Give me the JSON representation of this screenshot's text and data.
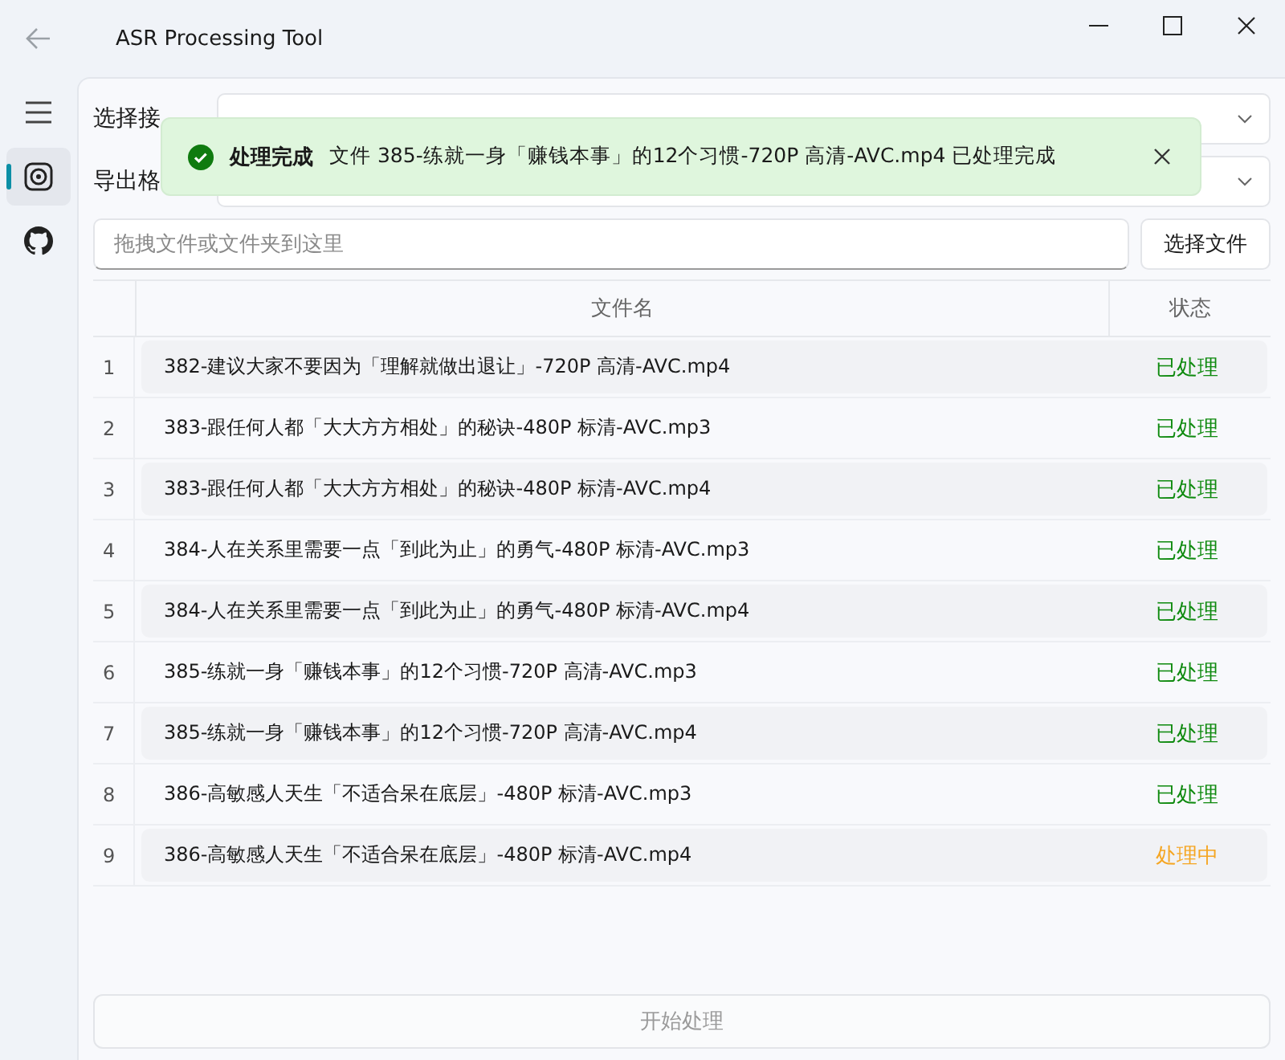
{
  "window": {
    "title": "ASR Processing Tool"
  },
  "sidebar": {
    "items": [
      {
        "kind": "menu",
        "selected": false
      },
      {
        "kind": "disc",
        "selected": true
      },
      {
        "kind": "github",
        "selected": false
      }
    ]
  },
  "form": {
    "interface_label": "选择接",
    "format_label": "导出格",
    "drop_placeholder": "拖拽文件或文件夹到这里",
    "choose_button": "选择文件"
  },
  "toast": {
    "title": "处理完成",
    "message": "文件 385-练就一身「赚钱本事」的12个习惯-720P 高清-AVC.mp4 已处理完成"
  },
  "table": {
    "columns": [
      "文件名",
      "状态"
    ],
    "rows": [
      {
        "index": "1",
        "name": "382-建议大家不要因为「理解就做出退让」-720P 高清-AVC.mp4",
        "status": "已处理",
        "kind": "done"
      },
      {
        "index": "2",
        "name": "383-跟任何人都「大大方方相处」的秘诀-480P 标清-AVC.mp3",
        "status": "已处理",
        "kind": "done"
      },
      {
        "index": "3",
        "name": "383-跟任何人都「大大方方相处」的秘诀-480P 标清-AVC.mp4",
        "status": "已处理",
        "kind": "done"
      },
      {
        "index": "4",
        "name": "384-人在关系里需要一点「到此为止」的勇气-480P 标清-AVC.mp3",
        "status": "已处理",
        "kind": "done"
      },
      {
        "index": "5",
        "name": "384-人在关系里需要一点「到此为止」的勇气-480P 标清-AVC.mp4",
        "status": "已处理",
        "kind": "done"
      },
      {
        "index": "6",
        "name": "385-练就一身「赚钱本事」的12个习惯-720P 高清-AVC.mp3",
        "status": "已处理",
        "kind": "done"
      },
      {
        "index": "7",
        "name": "385-练就一身「赚钱本事」的12个习惯-720P 高清-AVC.mp4",
        "status": "已处理",
        "kind": "done"
      },
      {
        "index": "8",
        "name": "386-高敏感人天生「不适合呆在底层」-480P 标清-AVC.mp3",
        "status": "已处理",
        "kind": "done"
      },
      {
        "index": "9",
        "name": "386-高敏感人天生「不适合呆在底层」-480P 标清-AVC.mp4",
        "status": "处理中",
        "kind": "processing"
      }
    ]
  },
  "start_button": {
    "label": "开始处理",
    "disabled": true
  }
}
